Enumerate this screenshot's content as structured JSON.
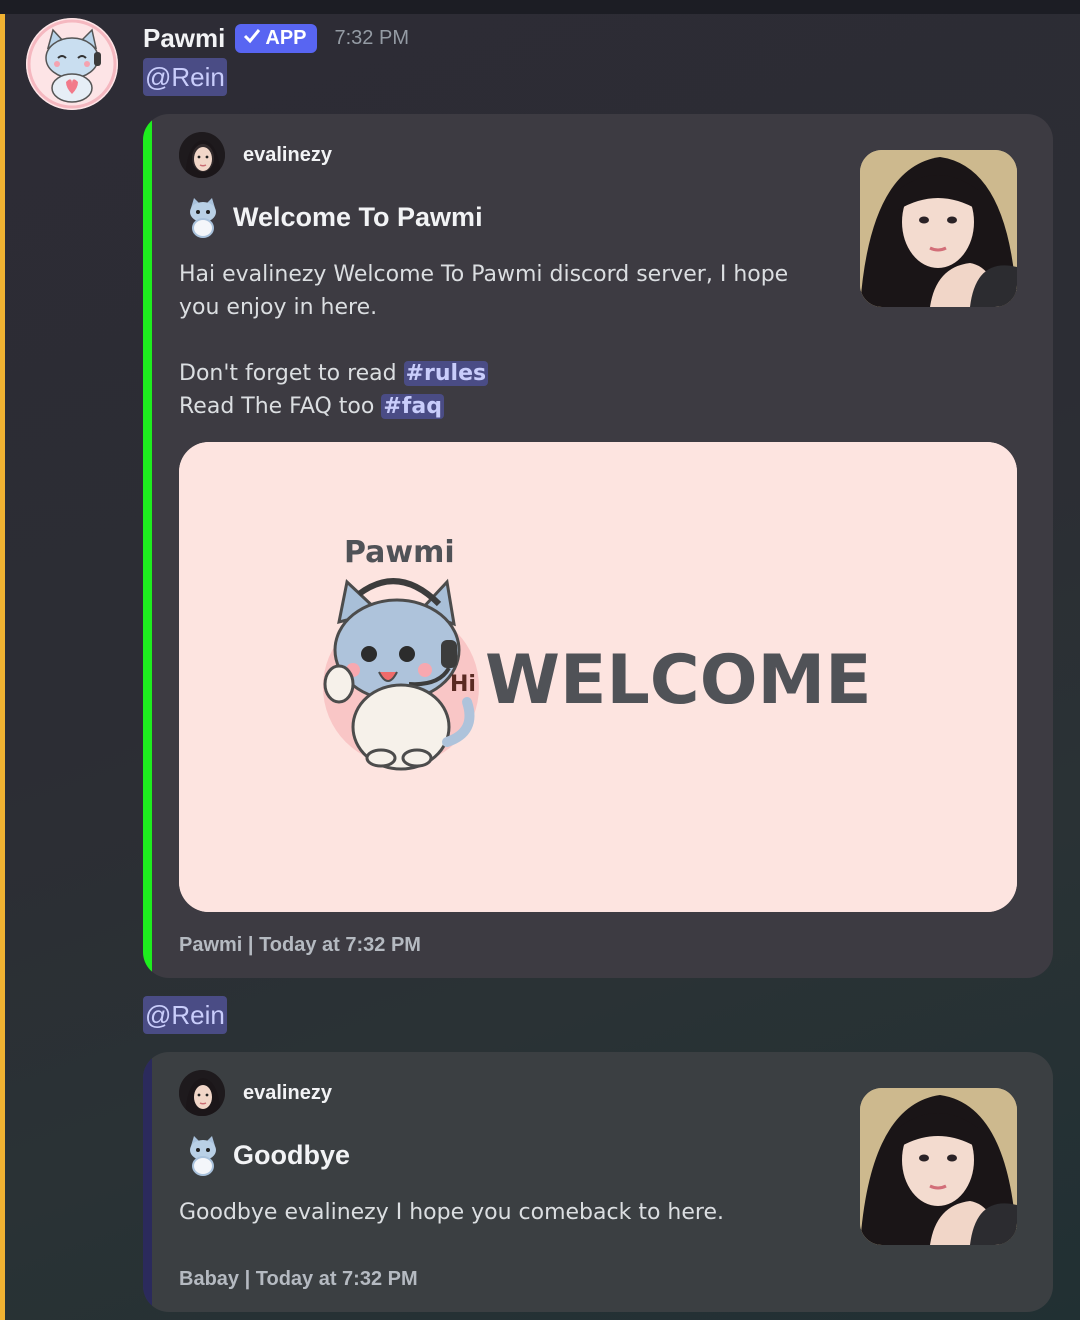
{
  "message": {
    "author": "Pawmi",
    "badge": "APP",
    "time": "7:32 PM"
  },
  "welcome": {
    "mention": "@Rein",
    "accent_color": "#1eee1e",
    "author": "evalinezy",
    "title": "Welcome To Pawmi",
    "desc_line1": "Hai evalinezy Welcome To Pawmi discord server, I hope you enjoy in here.",
    "desc_line2_text": "Don't forget to read ",
    "desc_line2_channel": "#rules",
    "desc_line3_text": "Read The FAQ too ",
    "desc_line3_channel": "#faq",
    "banner": {
      "brand": "Pawmi",
      "hi": "Hi",
      "heading": "WELCOME"
    },
    "footer": "Pawmi | Today at 7:32 PM"
  },
  "goodbye": {
    "mention": "@Rein",
    "accent_color": "#2b2a5c",
    "author": "evalinezy",
    "title": "Goodbye",
    "desc": "Goodbye evalinezy I hope you comeback to here.",
    "footer": "Babay | Today at 7:32 PM"
  },
  "icons": [
    "cat-avatar-icon",
    "check-icon",
    "cat-emoji-icon",
    "user-photo"
  ]
}
